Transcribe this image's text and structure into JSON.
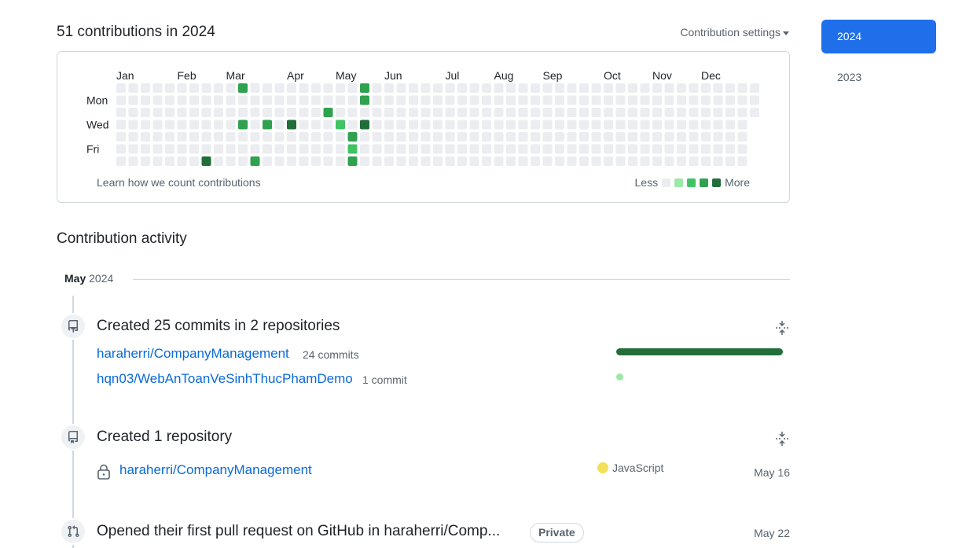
{
  "contributions": {
    "heading": "51 contributions in 2024",
    "settings_label": "Contribution settings",
    "months": [
      "Jan",
      "Feb",
      "Mar",
      "Apr",
      "May",
      "Jun",
      "Jul",
      "Aug",
      "Sep",
      "Oct",
      "Nov",
      "Dec"
    ],
    "day_labels": [
      "Mon",
      "Wed",
      "Fri"
    ],
    "learn_link": "Learn how we count contributions",
    "legend_less": "Less",
    "legend_more": "More",
    "level_colors": [
      "#ebedf0",
      "#9be9a8",
      "#40c463",
      "#30a14e",
      "#216e39"
    ],
    "active_cells": [
      {
        "week": 10,
        "day": 0,
        "level": 3
      },
      {
        "week": 10,
        "day": 3,
        "level": 3
      },
      {
        "week": 11,
        "day": 6,
        "level": 3
      },
      {
        "week": 12,
        "day": 3,
        "level": 3
      },
      {
        "week": 14,
        "day": 3,
        "level": 4
      },
      {
        "week": 17,
        "day": 2,
        "level": 3
      },
      {
        "week": 18,
        "day": 3,
        "level": 2
      },
      {
        "week": 19,
        "day": 4,
        "level": 3
      },
      {
        "week": 19,
        "day": 5,
        "level": 2
      },
      {
        "week": 19,
        "day": 6,
        "level": 3
      },
      {
        "week": 20,
        "day": 0,
        "level": 3
      },
      {
        "week": 20,
        "day": 1,
        "level": 3
      },
      {
        "week": 20,
        "day": 3,
        "level": 4
      },
      {
        "week": 7,
        "day": 6,
        "level": 4
      }
    ]
  },
  "years": [
    "2024",
    "2023"
  ],
  "activity": {
    "heading": "Contribution activity",
    "month": "May",
    "year": "2024",
    "commits": {
      "title": "Created 25 commits in 2 repositories",
      "repos": [
        {
          "name": "haraherri/CompanyManagement",
          "count_label": "24 commits",
          "commits": 24,
          "bar_color": "#216e39"
        },
        {
          "name": "hqn03/WebAnToanVeSinhThucPhamDemo",
          "count_label": "1 commit",
          "commits": 1,
          "bar_color": "#9be9a8"
        }
      ]
    },
    "repository": {
      "title": "Created 1 repository",
      "name": "haraherri/CompanyManagement",
      "language": "JavaScript",
      "language_color": "#f1e05a",
      "date": "May 16"
    },
    "pull_request": {
      "title": "Opened their first pull request on GitHub in haraherri/Comp...",
      "badge": "Private",
      "date": "May 22"
    }
  }
}
